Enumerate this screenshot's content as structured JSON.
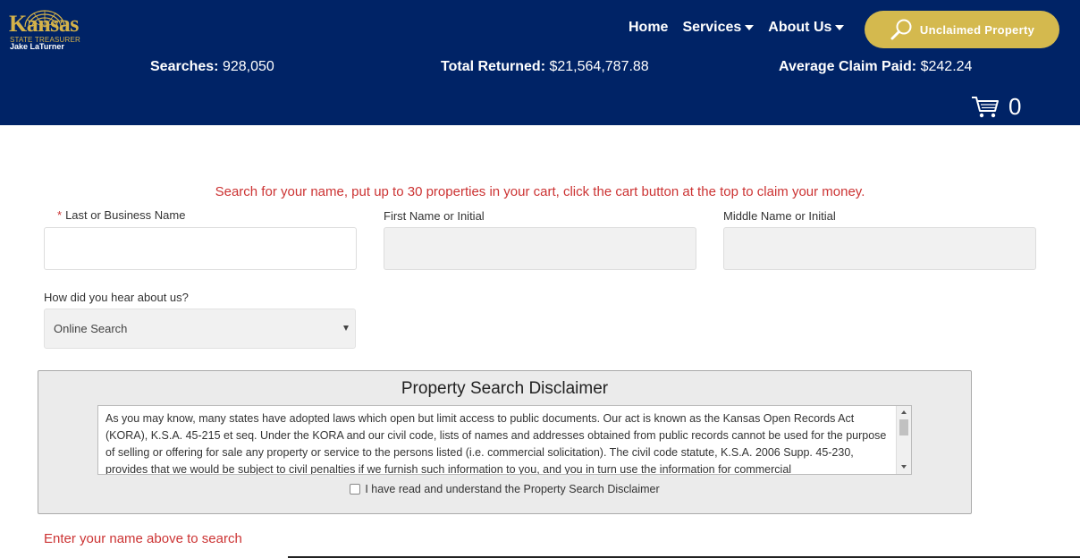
{
  "logo": {
    "main": "Kansas",
    "line1": "STATE TREASURER",
    "line2": "Jake LaTurner"
  },
  "nav": {
    "home": "Home",
    "services": "Services",
    "about": "About Us",
    "unclaimed": "Unclaimed Property"
  },
  "stats": {
    "searches_label": "Searches:",
    "searches_value": "928,050",
    "returned_label": "Total Returned:",
    "returned_value": "$21,564,787.88",
    "average_label": "Average Claim Paid:",
    "average_value": "$242.24"
  },
  "cart": {
    "count": "0"
  },
  "instructions": "Search for your name, put up to 30 properties in your cart, click the cart button at the top to claim your money.",
  "form": {
    "required_mark": "*",
    "last_label": "Last or Business Name",
    "first_label": "First Name or Initial",
    "middle_label": "Middle Name or Initial",
    "hear_label": "How did you hear about us?",
    "hear_value": "Online Search"
  },
  "disclaimer": {
    "title": "Property Search Disclaimer",
    "text": "As you may know, many states have adopted laws which open but limit access to public documents. Our act is known as the Kansas Open Records Act (KORA), K.S.A. 45-215 et seq. Under the KORA and our civil code, lists of names and addresses obtained from public records cannot be used for the purpose of selling or offering for sale any property or service to the persons listed (i.e. commercial solicitation). The civil code statute, K.S.A. 2006 Supp. 45-230, provides that we would be subject to civil penalties if we furnish such information to you, and you in turn use the information for commercial",
    "agree_label": "I have read and understand the Property Search Disclaimer"
  },
  "status_message": "Enter your name above to search",
  "colors": {
    "header_bg": "#002366",
    "gold": "#d4b94e",
    "accent_red": "#cc3333"
  }
}
